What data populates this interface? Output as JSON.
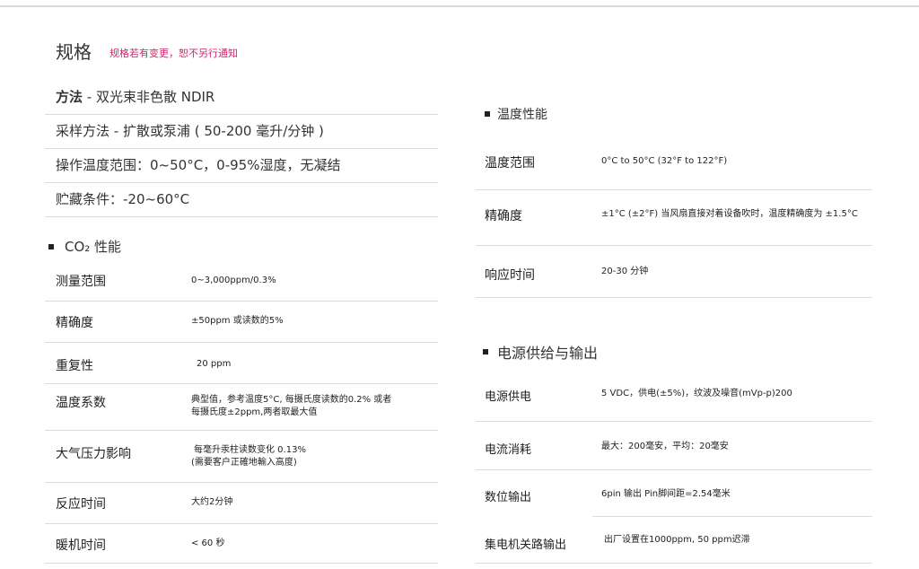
{
  "header": {
    "title": "规格",
    "notice": "规格若有变更，恕不另行通知"
  },
  "left": {
    "simple_rows": [
      {
        "bold": "方法",
        "text": " - 双光束非色散 NDIR"
      },
      {
        "bold": "",
        "text": "采样方法 - 扩散或泵浦 ( 50-200 毫升/分钟 )"
      },
      {
        "bold": "",
        "text": "操作温度范围：0~50°C，0-95%湿度，无凝结"
      },
      {
        "bold": "",
        "text": "贮藏条件：-20~60°C"
      }
    ],
    "co2_section": {
      "title": "CO₂ 性能",
      "rows": [
        {
          "label": "测量范围",
          "value": "0~3,000ppm/0.3%",
          "value2": ""
        },
        {
          "label": "精确度",
          "value": "±50ppm 或读数的5%",
          "value2": ""
        },
        {
          "label": "重复性",
          "value": "20 ppm",
          "value2": ""
        },
        {
          "label": "温度系数",
          "value": "典型值，参考温度5°C, 每摄氏度读数的0.2% 或者",
          "value2": "每摄氏度±2ppm,两者取最大值"
        },
        {
          "label": "大气压力影响",
          "value": "每毫升汞柱读数变化 0.13%",
          "value2": "(需要客户正確地輸入高度)"
        },
        {
          "label": "反应时间",
          "value": "大约2分钟",
          "value2": ""
        },
        {
          "label": "暖机时间",
          "value": "< 60 秒",
          "value2": ""
        }
      ]
    }
  },
  "right": {
    "temp_section": {
      "title": "温度性能",
      "rows": [
        {
          "label": "温度范围",
          "value": "0°C to 50°C (32°F to 122°F)"
        },
        {
          "label": "精确度",
          "value": "±1°C (±2°F) 当风扇直接对着设备吹时，温度精确度为 ±1.5°C"
        },
        {
          "label": "响应时间",
          "value": "20-30 分钟"
        }
      ]
    },
    "power_section": {
      "title": "电源供给与输出",
      "rows": [
        {
          "label": "电源供电",
          "value": "5 VDC，供电(±5%)，纹波及噪音(mVp-p)200"
        },
        {
          "label": "电流消耗",
          "value": "最大：200毫安，平均：20毫安"
        },
        {
          "label": "数位输出",
          "value": "6pin 输出 Pin脚间距=2.54毫米"
        },
        {
          "label": "集电机关路输出",
          "value": "出厂设置在1000ppm, 50 ppm迟滞"
        }
      ]
    }
  }
}
